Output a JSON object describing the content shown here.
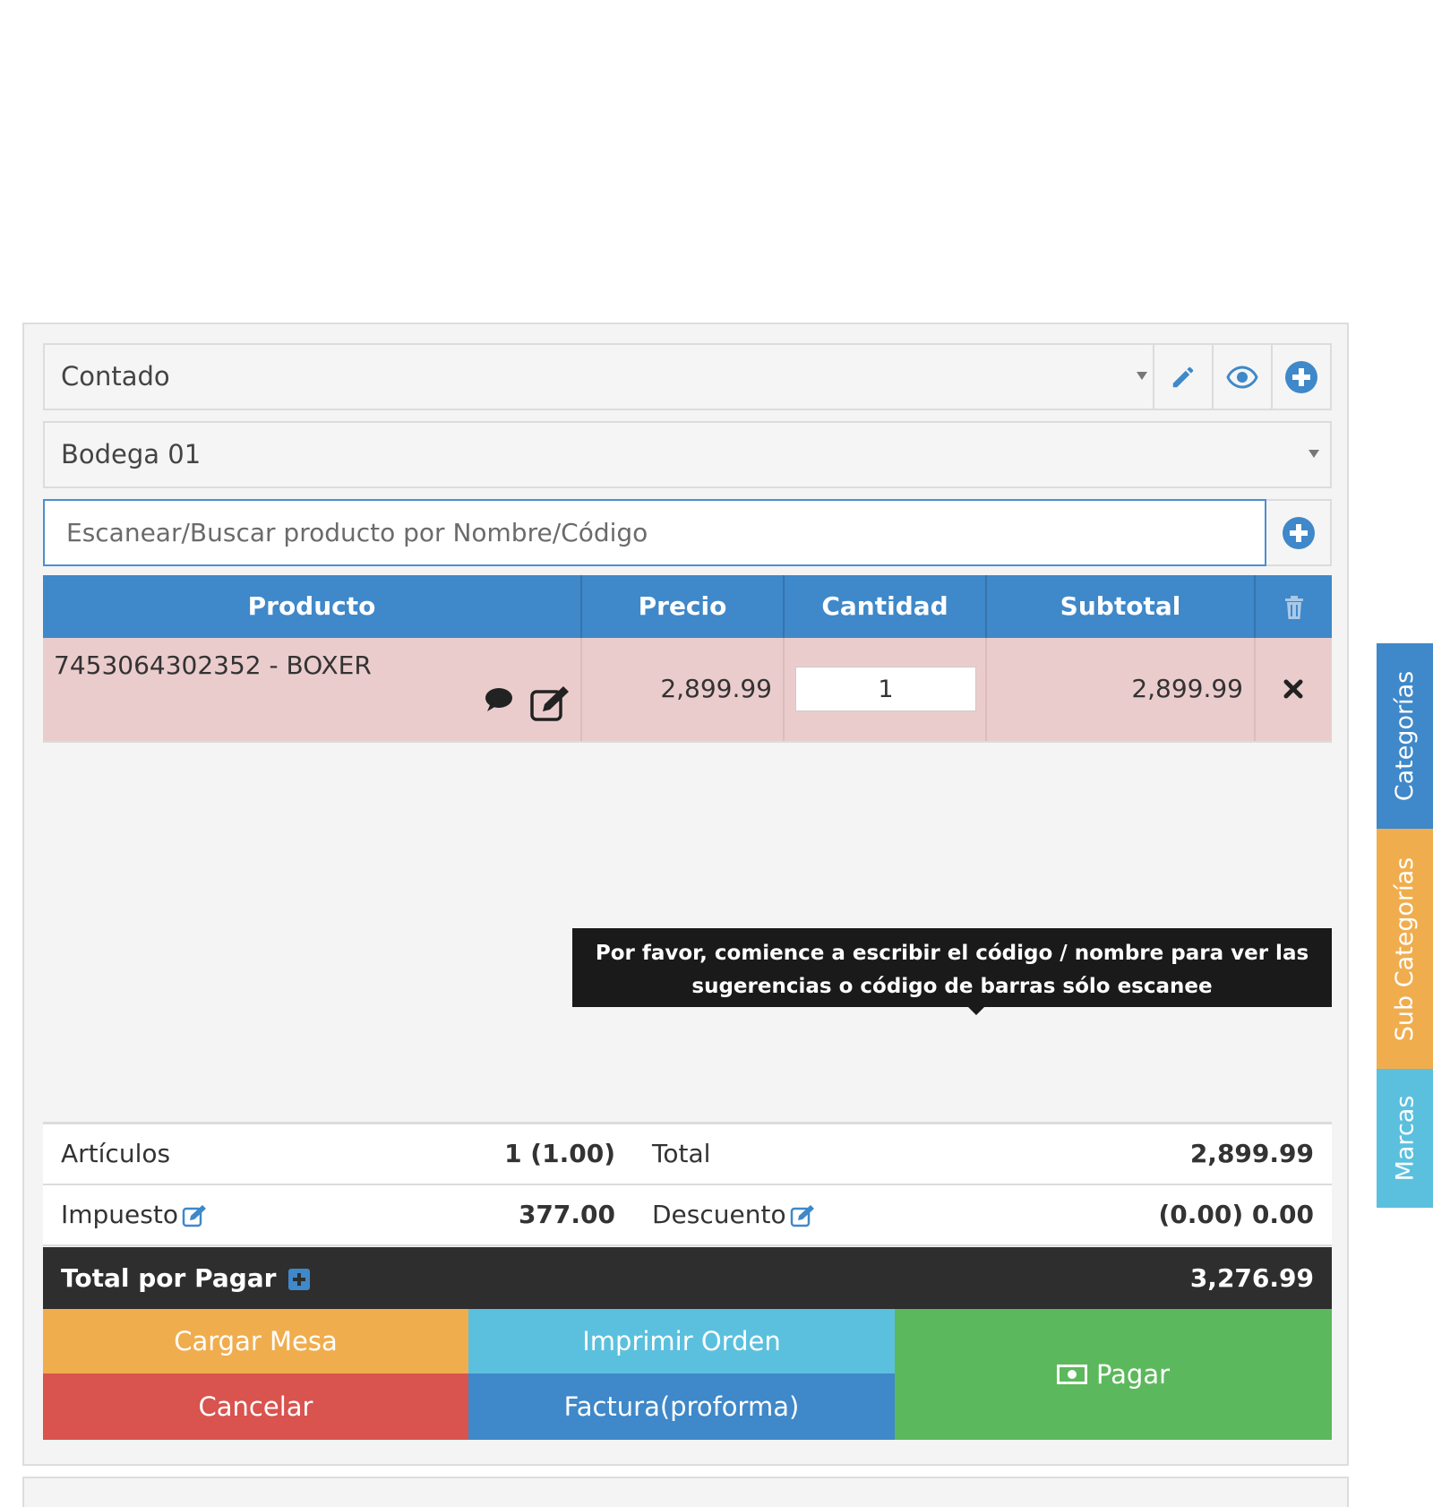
{
  "customer_select": {
    "value": "Contado"
  },
  "warehouse_select": {
    "value": "Bodega 01"
  },
  "search": {
    "placeholder": "Escanear/Buscar producto por Nombre/Código"
  },
  "table": {
    "headers": {
      "product": "Producto",
      "price": "Precio",
      "quantity": "Cantidad",
      "subtotal": "Subtotal"
    },
    "rows": [
      {
        "product": "7453064302352 - BOXER",
        "price": "2,899.99",
        "quantity": "1",
        "subtotal": "2,899.99"
      }
    ]
  },
  "tooltip": {
    "line1": "Por favor, comience a escribir el código / nombre para ver las",
    "line2": "sugerencias o código de barras sólo escanee"
  },
  "totals": {
    "items_label": "Artículos",
    "items_value": "1 (1.00)",
    "total_label": "Total",
    "total_value": "2,899.99",
    "tax_label": "Impuesto",
    "tax_value": "377.00",
    "discount_label": "Descuento",
    "discount_value": "(0.00) 0.00",
    "grand_label": "Total por Pagar",
    "grand_value": "3,276.99"
  },
  "buttons": {
    "load_table": "Cargar Mesa",
    "print_order": "Imprimir Orden",
    "pay": "Pagar",
    "cancel": "Cancelar",
    "proforma": "Factura(proforma)"
  },
  "side_tabs": {
    "categories": "Categorías",
    "sub_categories": "Sub Categorías",
    "brands": "Marcas"
  },
  "colors": {
    "primary": "#3f88c9",
    "warning": "#f0ad4e",
    "info": "#5bc0de",
    "success": "#5cb85c",
    "danger": "#d9534f",
    "dark": "#2e2e2e",
    "row_highlight": "#ebcccc"
  }
}
